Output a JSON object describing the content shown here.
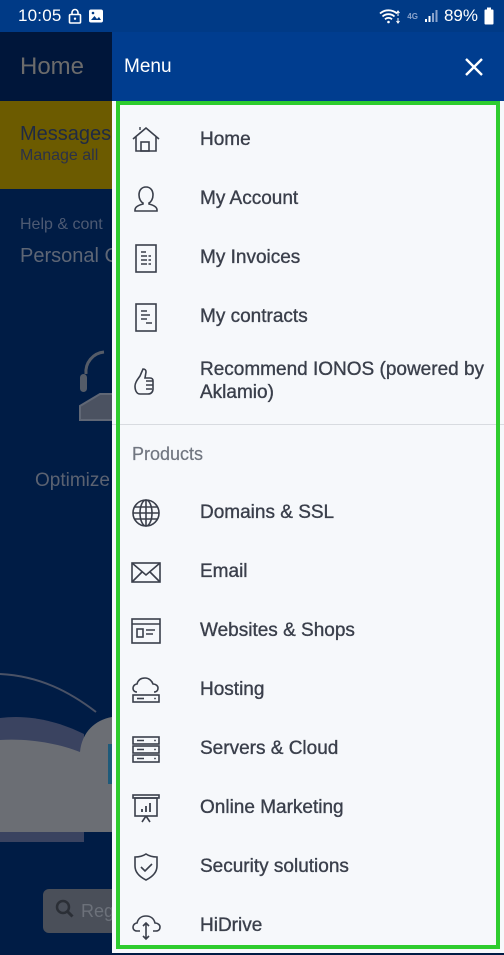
{
  "status_bar": {
    "time": "10:05",
    "left_icons": [
      "lock-icon",
      "image-icon"
    ],
    "right_icons": [
      "wifi-icon",
      "network-4g-icon",
      "signal-icon",
      "battery-icon"
    ],
    "network_label": "4G",
    "battery_percent": "89%"
  },
  "background_app": {
    "header_title": "Home",
    "messages": {
      "title": "Messages",
      "subtitle": "Manage all"
    },
    "help": {
      "label": "Help & cont",
      "title": "Personal C"
    },
    "optimize_text": "Optimize",
    "search_placeholder": "Reg",
    "colors": {
      "overlay_bg": "#001c45",
      "messages_bg": "#6c5b00"
    }
  },
  "drawer": {
    "title": "Menu",
    "close_icon": "close-icon",
    "colors": {
      "header_bg": "#003d8f",
      "body_bg": "#f6f8fb",
      "text": "#3a3f4b",
      "highlight_border": "#2ecc2e"
    },
    "account_items": [
      {
        "id": "home",
        "label": "Home",
        "icon": "home-icon"
      },
      {
        "id": "my-account",
        "label": "My Account",
        "icon": "user-icon"
      },
      {
        "id": "my-invoices",
        "label": "My Invoices",
        "icon": "invoice-icon"
      },
      {
        "id": "my-contracts",
        "label": "My contracts",
        "icon": "contract-icon"
      },
      {
        "id": "recommend",
        "label": "Recommend IONOS (powered by Aklamio)",
        "icon": "thumbs-up-icon"
      }
    ],
    "products_section_title": "Products",
    "product_items": [
      {
        "id": "domains-ssl",
        "label": "Domains & SSL",
        "icon": "globe-icon"
      },
      {
        "id": "email",
        "label": "Email",
        "icon": "envelope-icon"
      },
      {
        "id": "websites-shops",
        "label": "Websites & Shops",
        "icon": "website-icon"
      },
      {
        "id": "hosting",
        "label": "Hosting",
        "icon": "cloud-server-icon"
      },
      {
        "id": "servers-cloud",
        "label": "Servers & Cloud",
        "icon": "server-stack-icon"
      },
      {
        "id": "online-marketing",
        "label": "Online Marketing",
        "icon": "presentation-chart-icon"
      },
      {
        "id": "security-solutions",
        "label": "Security solutions",
        "icon": "shield-check-icon"
      },
      {
        "id": "hidrive",
        "label": "HiDrive",
        "icon": "cloud-sync-icon"
      }
    ]
  }
}
